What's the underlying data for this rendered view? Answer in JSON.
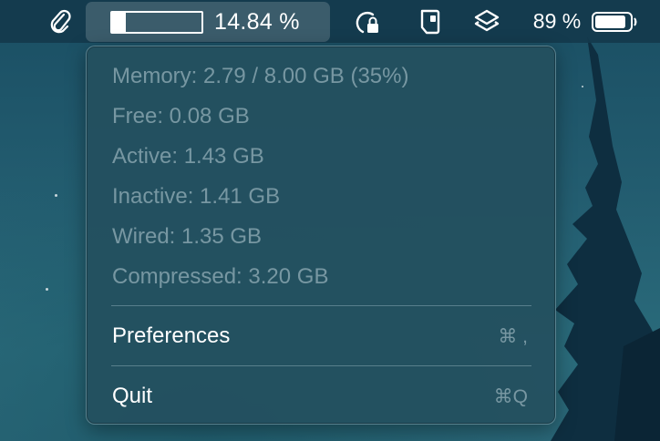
{
  "menubar": {
    "memory_percent_text": "14.84 %",
    "memory_bar_fraction": 0.148,
    "battery_percent_text": "89 %",
    "battery_fraction": 0.89,
    "icons": [
      "paperclip-icon",
      "app-lock-icon",
      "wallet-icon",
      "layers-icon",
      "battery-icon"
    ]
  },
  "dropdown": {
    "info": {
      "memory": "Memory: 2.79 / 8.00 GB (35%)",
      "free": "Free: 0.08 GB",
      "active": "Active: 1.43 GB",
      "inactive": "Inactive: 1.41 GB",
      "wired": "Wired: 1.35 GB",
      "compressed": "Compressed: 3.20 GB"
    },
    "items": [
      {
        "label": "Preferences",
        "shortcut": "⌘ ,"
      },
      {
        "label": "Quit",
        "shortcut": "⌘Q"
      }
    ]
  },
  "colors": {
    "menubar_bg": "#143a4c",
    "menu_bg": "#23505f",
    "text_primary": "#ffffff",
    "text_disabled": "#8fa6ad"
  }
}
